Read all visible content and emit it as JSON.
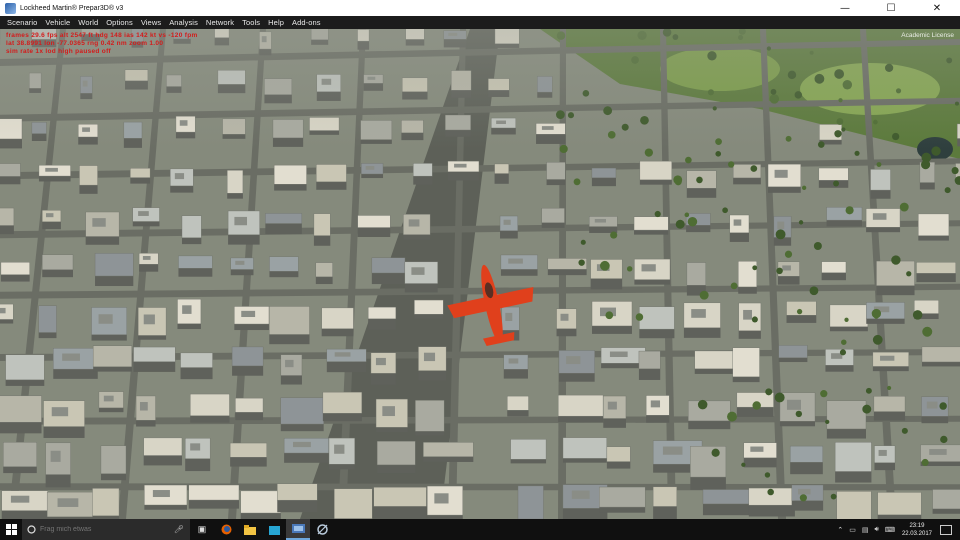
{
  "window": {
    "title": "Lockheed Martin® Prepar3D® v3",
    "minimize": "—",
    "maximize": "☐",
    "close": "✕"
  },
  "menu": [
    "Scenario",
    "Vehicle",
    "World",
    "Options",
    "Views",
    "Analysis",
    "Network",
    "Tools",
    "Help",
    "Add-ons"
  ],
  "viewport": {
    "license_label": "Academic License",
    "debug_lines": [
      "frames 29.6 fps  alt 2547 ft  hdg 148  ias 142 kt  vs -120 fpm",
      "lat 38.8991  lon -77.0365  rng 0.42 nm  zoom 1.00",
      "sim rate 1x  lod high  paused off"
    ],
    "aircraft_color": "#e0401c"
  },
  "taskbar": {
    "search_placeholder": "Frag mich etwas",
    "icons": [
      "task-view-icon",
      "firefox-icon",
      "file-explorer-icon",
      "store-icon",
      "prepar3d-icon",
      "network-tool-icon"
    ],
    "time": "23:19",
    "date": "22.03.2017"
  }
}
